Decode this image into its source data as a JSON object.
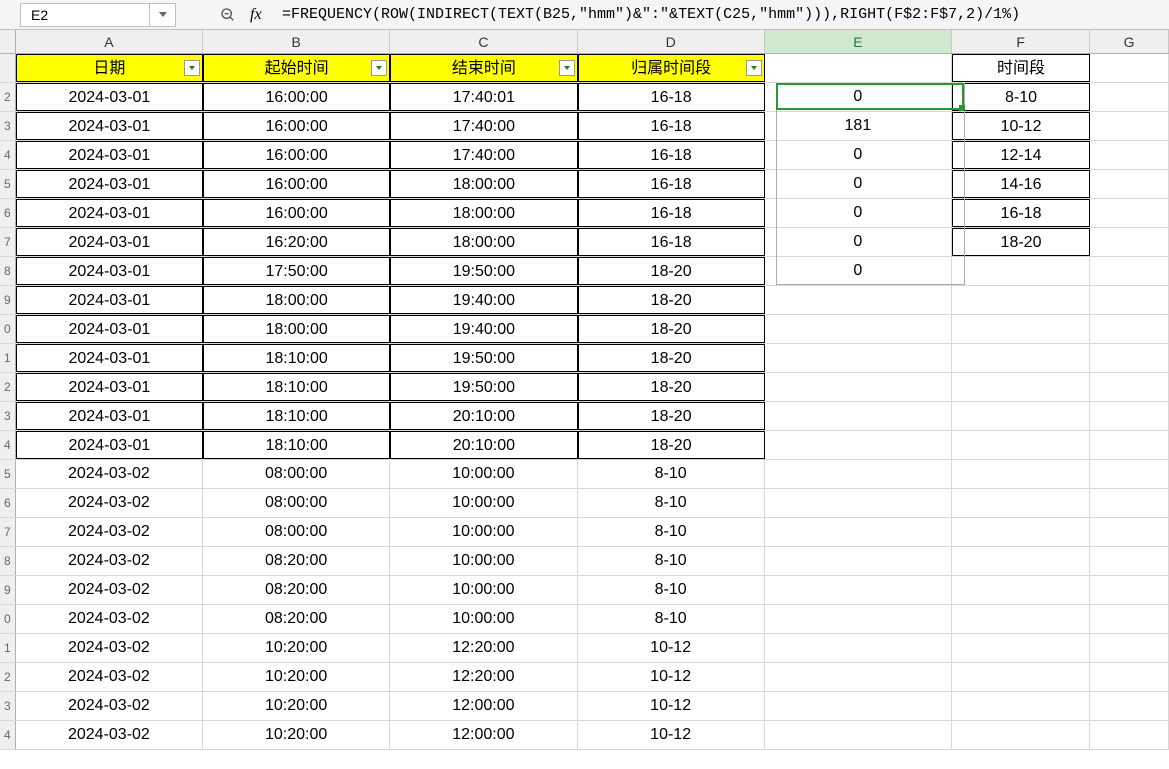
{
  "formulaBar": {
    "cellRef": "E2",
    "fxLabel": "fx",
    "formula": "=FREQUENCY(ROW(INDIRECT(TEXT(B25,\"hmm\")&\":\"&TEXT(C25,\"hmm\"))),RIGHT(F$2:F$7,2)/1%)"
  },
  "columns": {
    "A": "A",
    "B": "B",
    "C": "C",
    "D": "D",
    "E": "E",
    "F": "F",
    "G": "G"
  },
  "headers": {
    "A": "日期",
    "B": "起始时间",
    "C": "结束时间",
    "D": "归属时间段",
    "E": "",
    "F": "时间段"
  },
  "rows": [
    {
      "n": "2",
      "A": "2024-03-01",
      "B": "16:00:00",
      "C": "17:40:01",
      "D": "16-18",
      "E": "0",
      "F": "8-10"
    },
    {
      "n": "3",
      "A": "2024-03-01",
      "B": "16:00:00",
      "C": "17:40:00",
      "D": "16-18",
      "E": "181",
      "F": "10-12"
    },
    {
      "n": "4",
      "A": "2024-03-01",
      "B": "16:00:00",
      "C": "17:40:00",
      "D": "16-18",
      "E": "0",
      "F": "12-14"
    },
    {
      "n": "5",
      "A": "2024-03-01",
      "B": "16:00:00",
      "C": "18:00:00",
      "D": "16-18",
      "E": "0",
      "F": "14-16"
    },
    {
      "n": "6",
      "A": "2024-03-01",
      "B": "16:00:00",
      "C": "18:00:00",
      "D": "16-18",
      "E": "0",
      "F": "16-18"
    },
    {
      "n": "7",
      "A": "2024-03-01",
      "B": "16:20:00",
      "C": "18:00:00",
      "D": "16-18",
      "E": "0",
      "F": "18-20"
    },
    {
      "n": "8",
      "A": "2024-03-01",
      "B": "17:50:00",
      "C": "19:50:00",
      "D": "18-20",
      "E": "0",
      "F": ""
    },
    {
      "n": "9",
      "A": "2024-03-01",
      "B": "18:00:00",
      "C": "19:40:00",
      "D": "18-20",
      "E": "",
      "F": ""
    },
    {
      "n": "0",
      "A": "2024-03-01",
      "B": "18:00:00",
      "C": "19:40:00",
      "D": "18-20",
      "E": "",
      "F": ""
    },
    {
      "n": "1",
      "A": "2024-03-01",
      "B": "18:10:00",
      "C": "19:50:00",
      "D": "18-20",
      "E": "",
      "F": ""
    },
    {
      "n": "2",
      "A": "2024-03-01",
      "B": "18:10:00",
      "C": "19:50:00",
      "D": "18-20",
      "E": "",
      "F": ""
    },
    {
      "n": "3",
      "A": "2024-03-01",
      "B": "18:10:00",
      "C": "20:10:00",
      "D": "18-20",
      "E": "",
      "F": ""
    },
    {
      "n": "4",
      "A": "2024-03-01",
      "B": "18:10:00",
      "C": "20:10:00",
      "D": "18-20",
      "E": "",
      "F": ""
    },
    {
      "n": "5",
      "A": "2024-03-02",
      "B": "08:00:00",
      "C": "10:00:00",
      "D": "8-10",
      "E": "",
      "F": ""
    },
    {
      "n": "6",
      "A": "2024-03-02",
      "B": "08:00:00",
      "C": "10:00:00",
      "D": "8-10",
      "E": "",
      "F": ""
    },
    {
      "n": "7",
      "A": "2024-03-02",
      "B": "08:00:00",
      "C": "10:00:00",
      "D": "8-10",
      "E": "",
      "F": ""
    },
    {
      "n": "8",
      "A": "2024-03-02",
      "B": "08:20:00",
      "C": "10:00:00",
      "D": "8-10",
      "E": "",
      "F": ""
    },
    {
      "n": "9",
      "A": "2024-03-02",
      "B": "08:20:00",
      "C": "10:00:00",
      "D": "8-10",
      "E": "",
      "F": ""
    },
    {
      "n": "0",
      "A": "2024-03-02",
      "B": "08:20:00",
      "C": "10:00:00",
      "D": "8-10",
      "E": "",
      "F": ""
    },
    {
      "n": "1",
      "A": "2024-03-02",
      "B": "10:20:00",
      "C": "12:20:00",
      "D": "10-12",
      "E": "",
      "F": ""
    },
    {
      "n": "2",
      "A": "2024-03-02",
      "B": "10:20:00",
      "C": "12:20:00",
      "D": "10-12",
      "E": "",
      "F": ""
    },
    {
      "n": "3",
      "A": "2024-03-02",
      "B": "10:20:00",
      "C": "12:00:00",
      "D": "10-12",
      "E": "",
      "F": ""
    },
    {
      "n": "4",
      "A": "2024-03-02",
      "B": "10:20:00",
      "C": "12:00:00",
      "D": "10-12",
      "E": "",
      "F": ""
    }
  ],
  "borderedRowsD": 13,
  "borderedRowsF": 6,
  "activeCell": {
    "col": "E",
    "row": 2
  },
  "selectionRange": {
    "col": "E",
    "startRow": 2,
    "endRow": 8
  }
}
